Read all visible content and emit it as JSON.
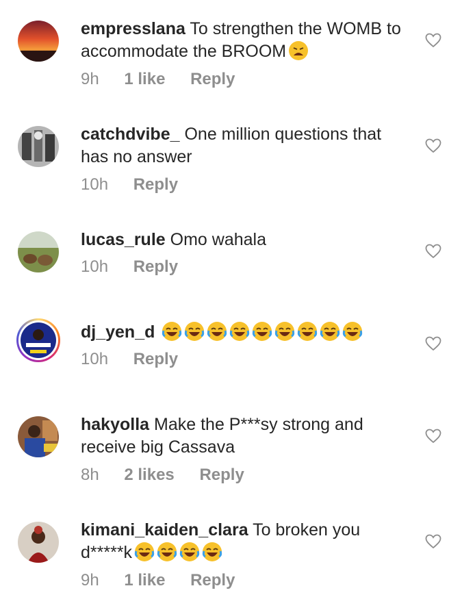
{
  "comments": [
    {
      "username": "empresslana",
      "text": "To strengthen the WOMB to accommodate the BROOM",
      "time": "9h",
      "likes": "1 like",
      "reply": "Reply",
      "emoji": "tired-face"
    },
    {
      "username": "catchdvibe_",
      "text": "One million questions that has no answer",
      "time": "10h",
      "reply": "Reply"
    },
    {
      "username": "lucas_rule",
      "text": "Omo wahala",
      "time": "10h",
      "reply": "Reply"
    },
    {
      "username": "dj_yen_d",
      "text": "",
      "time": "10h",
      "reply": "Reply",
      "emoji_count": 9,
      "emoji": "face-with-tears-of-joy"
    },
    {
      "username": "hakyolla",
      "text": "Make the P***sy strong and receive big Cassava",
      "time": "8h",
      "likes": "2 likes",
      "reply": "Reply"
    },
    {
      "username": "kimani_kaiden_clara",
      "text": "To broken you d*****k",
      "time": "9h",
      "likes": "1 like",
      "reply": "Reply",
      "emoji_count": 4,
      "emoji": "face-with-tears-of-joy"
    }
  ],
  "colors": {
    "text": "#262626",
    "meta": "#8e8e8e",
    "heart": "#8e8e8e"
  }
}
